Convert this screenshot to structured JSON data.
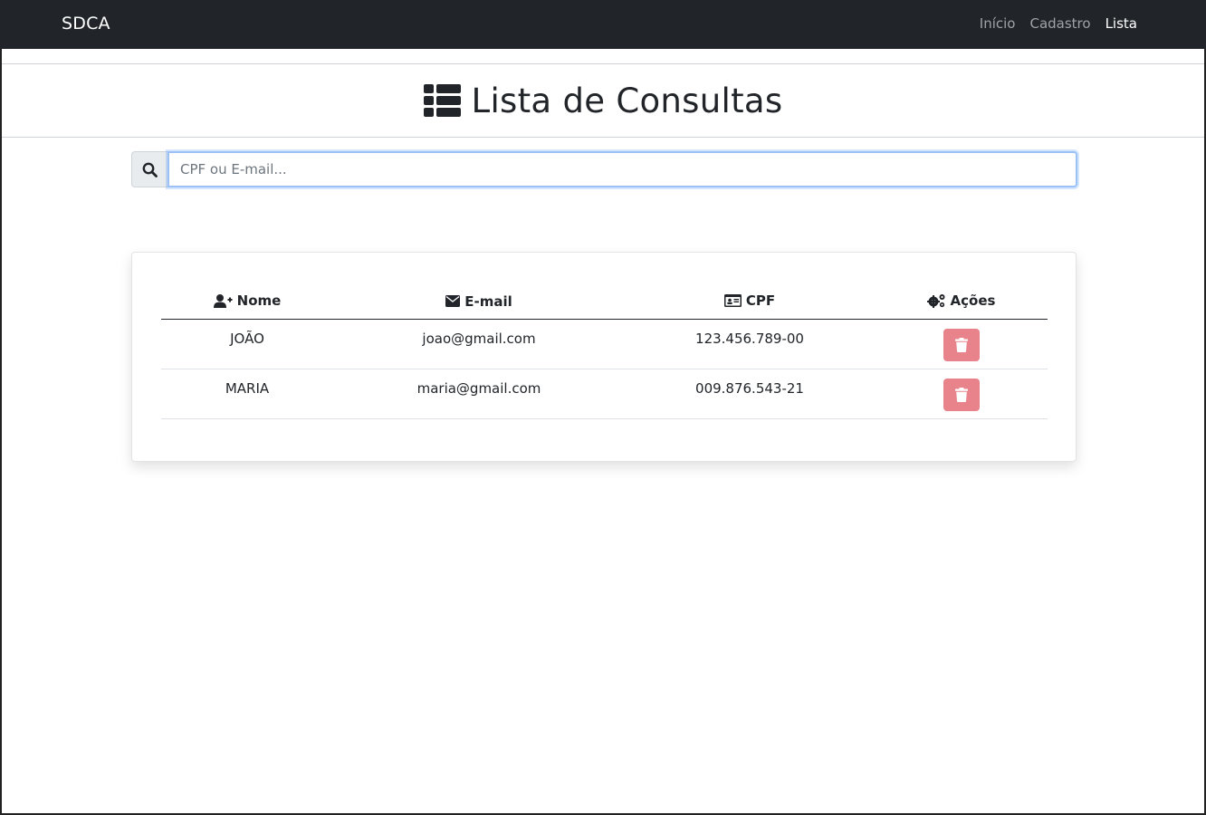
{
  "navbar": {
    "brand": "SDCA",
    "links": [
      {
        "label": "Início",
        "active": false
      },
      {
        "label": "Cadastro",
        "active": false
      },
      {
        "label": "Lista",
        "active": true
      }
    ]
  },
  "header": {
    "title": "Lista de Consultas",
    "icon": "list-icon"
  },
  "search": {
    "icon": "search-icon",
    "placeholder": "CPF ou E-mail...",
    "value": ""
  },
  "table": {
    "columns": [
      {
        "label": "Nome",
        "icon": "user-plus-icon"
      },
      {
        "label": "E-mail",
        "icon": "envelope-icon"
      },
      {
        "label": "CPF",
        "icon": "id-card-icon"
      },
      {
        "label": "Ações",
        "icon": "cogs-icon"
      }
    ],
    "rows": [
      {
        "nome": "JOÃO",
        "email": "joao@gmail.com",
        "cpf": "123.456.789-00",
        "action_icon": "trash-icon"
      },
      {
        "nome": "MARIA",
        "email": "maria@gmail.com",
        "cpf": "009.876.543-21",
        "action_icon": "trash-icon"
      }
    ]
  },
  "colors": {
    "navbar_bg": "#212529",
    "delete_button": "#e8828b",
    "focus_border": "#9cc2f5"
  }
}
